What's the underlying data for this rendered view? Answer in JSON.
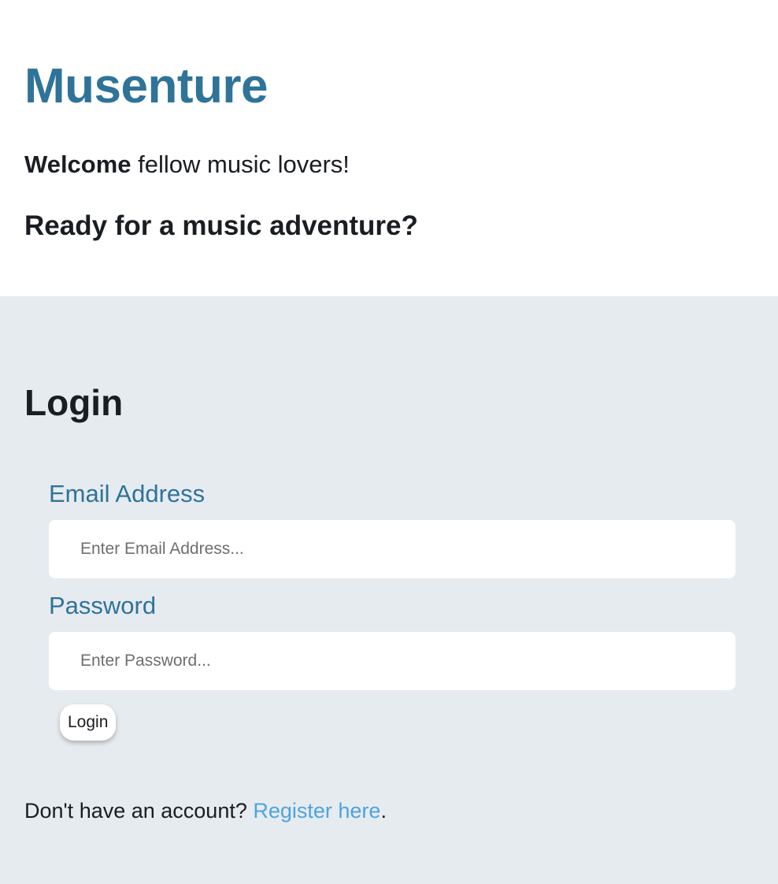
{
  "header": {
    "app_title": "Musenture",
    "welcome_bold": "Welcome",
    "welcome_rest": " fellow music lovers!",
    "tagline": "Ready for a music adventure?"
  },
  "login": {
    "heading": "Login",
    "email_label": "Email Address",
    "email_placeholder": "Enter Email Address...",
    "email_value": "",
    "password_label": "Password",
    "password_placeholder": "Enter Password...",
    "password_value": "",
    "submit_label": "Login"
  },
  "footer": {
    "prompt": "Don't have an account? ",
    "register_link": "Register here",
    "suffix": "."
  },
  "colors": {
    "brand": "#2f7399",
    "link": "#4ea3de",
    "section_bg": "#e6ebf0"
  }
}
